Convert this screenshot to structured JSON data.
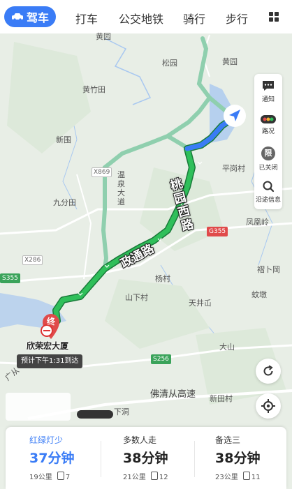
{
  "modes": [
    "驾车",
    "打车",
    "公交地铁",
    "骑行",
    "步行"
  ],
  "active_mode": "驾车",
  "side_panel": [
    {
      "label": "通知",
      "icon": "message-icon"
    },
    {
      "label": "路况",
      "icon": "traffic-light-icon"
    },
    {
      "label": "已关闭",
      "icon": "restrict-icon",
      "glyph": "限"
    },
    {
      "label": "沿途信息",
      "icon": "search-icon"
    }
  ],
  "map_labels": {
    "huangyuan_top": "黄园",
    "songyuan": "松园",
    "huangyuan_right": "黄园",
    "huangzhutian": "黄竹田",
    "xinwei": "新围",
    "wenquan": "温泉大道",
    "pinggang": "平岗村",
    "jiufentian": "九分田",
    "fenghuangling": "凤凰岭",
    "zhegang": "褶卜岡",
    "yangcun": "杨村",
    "shanxia": "山下村",
    "tianjing": "天井屲",
    "jiaodun": "蚊墩",
    "dashan": "大山",
    "xintian": "新田村",
    "xiadong": "下洞",
    "guangcong": "广从",
    "fuqing": "佛清从高速"
  },
  "road_labels": {
    "x869": "X869",
    "g355": "G355",
    "x286": "X286",
    "s355": "S355",
    "s256": "S256"
  },
  "route_text": {
    "road1": "桃园西路",
    "road2": "政通路"
  },
  "destination": {
    "marker": "终",
    "name": "欣荣宏大厦",
    "eta": "预计下午1:31到达"
  },
  "route_options": [
    {
      "tag": "红绿灯少",
      "time": "37分钟",
      "distance": "19公里",
      "lights": "7"
    },
    {
      "tag": "多数人走",
      "time": "38分钟",
      "distance": "21公里",
      "lights": "12"
    },
    {
      "tag": "备选三",
      "time": "38分钟",
      "distance": "23公里",
      "lights": "11"
    }
  ],
  "colors": {
    "accent": "#3a7cf6",
    "route": "#2fbf5a",
    "alt_route": "#8fcfae",
    "water": "#a9c8f0"
  }
}
